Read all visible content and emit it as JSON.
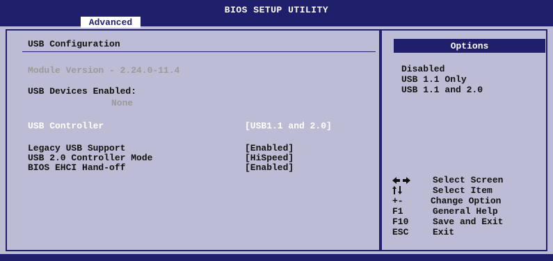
{
  "header": {
    "title": "BIOS SETUP UTILITY",
    "tabs": [
      {
        "label": "Advanced",
        "active": true
      }
    ]
  },
  "main": {
    "section_title": "USB Configuration",
    "module_version": "Module Version - 2.24.0-11.4",
    "devices_label": "USB Devices Enabled:",
    "devices_value": "None",
    "options": [
      {
        "label": "USB Controller",
        "value": "[USB1.1 and 2.0]",
        "selected": true
      },
      {
        "label": "Legacy USB Support",
        "value": "[Enabled]",
        "selected": false
      },
      {
        "label": "USB 2.0 Controller Mode",
        "value": "[HiSpeed]",
        "selected": false
      },
      {
        "label": "BIOS EHCI Hand-off",
        "value": "[Enabled]",
        "selected": false
      }
    ]
  },
  "help": {
    "options_header": "Options",
    "option_items": [
      "Disabled",
      "USB 1.1 Only",
      "USB 1.1 and 2.0"
    ],
    "keys": [
      {
        "icon": "left-right-arrows-icon",
        "key": "",
        "desc": "Select Screen"
      },
      {
        "icon": "up-down-arrows-icon",
        "key": "",
        "desc": "Select Item"
      },
      {
        "icon": "",
        "key": "+-",
        "desc": "Change Option"
      },
      {
        "icon": "",
        "key": "F1",
        "desc": "General Help"
      },
      {
        "icon": "",
        "key": "F10",
        "desc": "Save and Exit"
      },
      {
        "icon": "",
        "key": "ESC",
        "desc": "Exit"
      }
    ]
  },
  "colors": {
    "bar": "#1f1f6b",
    "panel": "#bcbcd4",
    "dim_text": "#9a9a9a",
    "selected_text": "#ffffff"
  }
}
